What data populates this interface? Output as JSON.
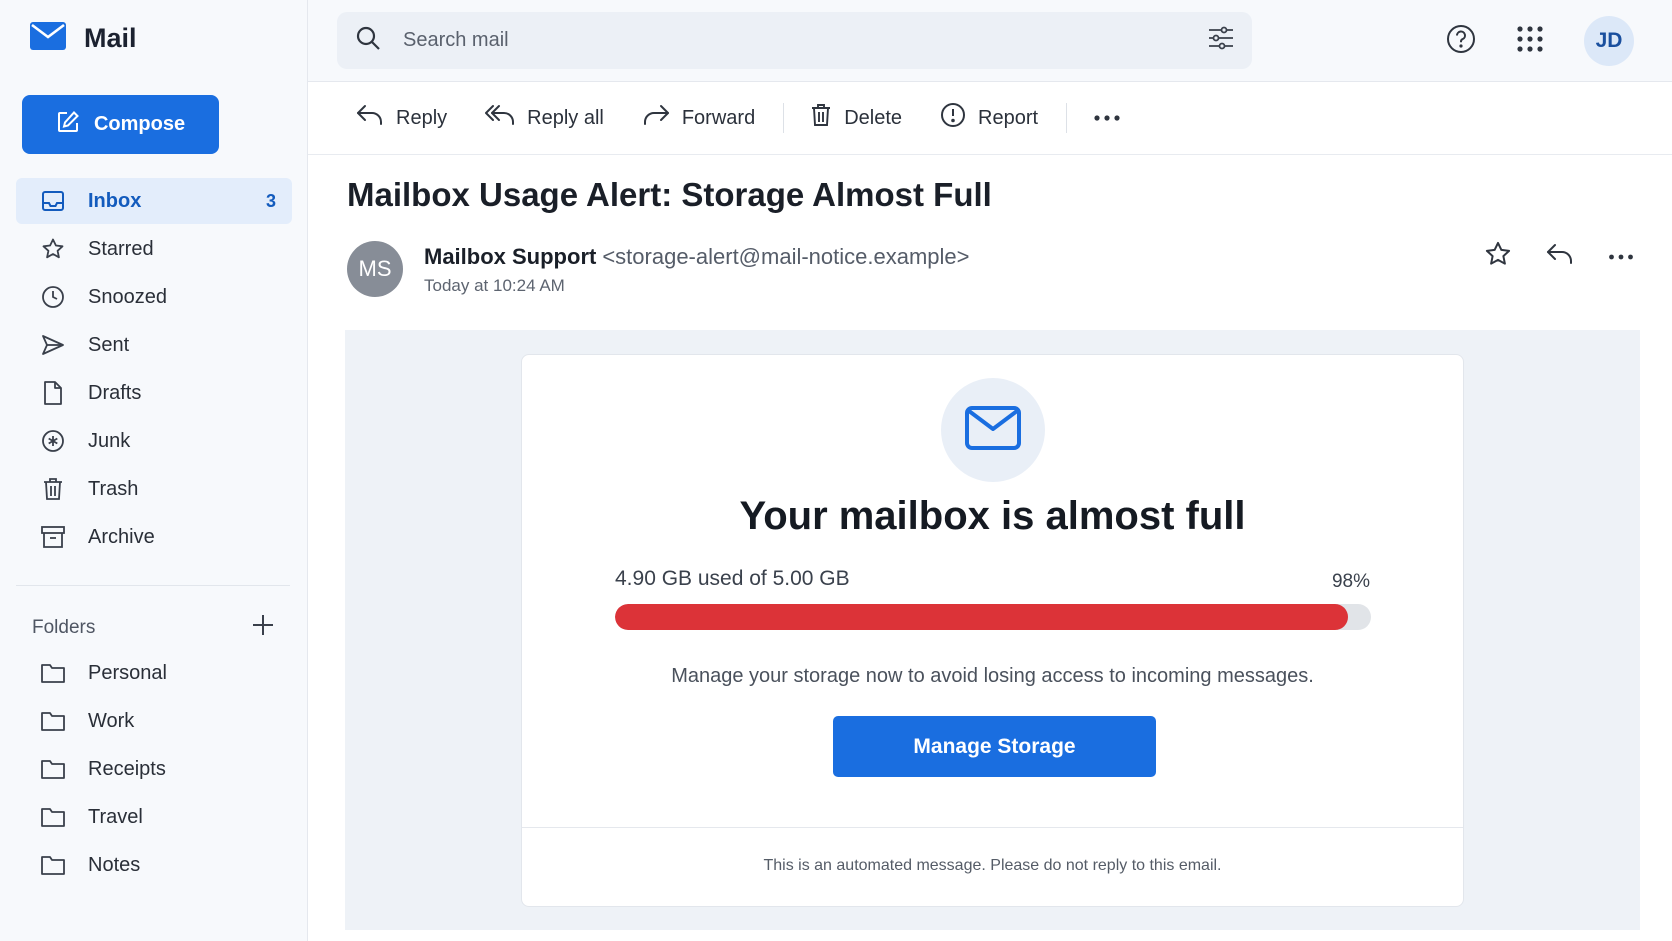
{
  "app": {
    "title": "Mail"
  },
  "compose": {
    "label": "Compose"
  },
  "nav": {
    "items": [
      {
        "label": "Inbox",
        "icon": "inbox-icon",
        "count": "3",
        "active": true
      },
      {
        "label": "Starred",
        "icon": "star-icon"
      },
      {
        "label": "Snoozed",
        "icon": "clock-icon"
      },
      {
        "label": "Sent",
        "icon": "send-icon"
      },
      {
        "label": "Drafts",
        "icon": "draft-icon"
      },
      {
        "label": "Junk",
        "icon": "junk-icon"
      },
      {
        "label": "Trash",
        "icon": "trash-icon"
      },
      {
        "label": "Archive",
        "icon": "archive-icon"
      }
    ]
  },
  "folders": {
    "label": "Folders",
    "items": [
      {
        "label": "Personal"
      },
      {
        "label": "Work"
      },
      {
        "label": "Receipts"
      },
      {
        "label": "Travel"
      },
      {
        "label": "Notes"
      }
    ]
  },
  "search": {
    "placeholder": "Search mail"
  },
  "user": {
    "initials": "JD"
  },
  "toolbar": {
    "reply": "Reply",
    "reply_all": "Reply all",
    "forward": "Forward",
    "delete": "Delete",
    "report": "Report"
  },
  "message": {
    "subject": "Mailbox Usage Alert: Storage Almost Full",
    "sender_initials": "MS",
    "sender_name": "Mailbox Support",
    "sender_email": "<storage-alert@mail-notice.example>",
    "time": "Today at 10:24 AM"
  },
  "email": {
    "heading": "Your mailbox is almost full",
    "usage_text": "4.90 GB used of 5.00 GB",
    "usage_percent_label": "98%",
    "usage_fraction": 0.97,
    "body": "Manage your storage now to avoid losing access to incoming messages.",
    "cta": "Manage Storage",
    "footer": "This is an automated message. Please do not reply to this email."
  },
  "colors": {
    "accent": "#1a6ee0",
    "alert": "#dc3338"
  }
}
